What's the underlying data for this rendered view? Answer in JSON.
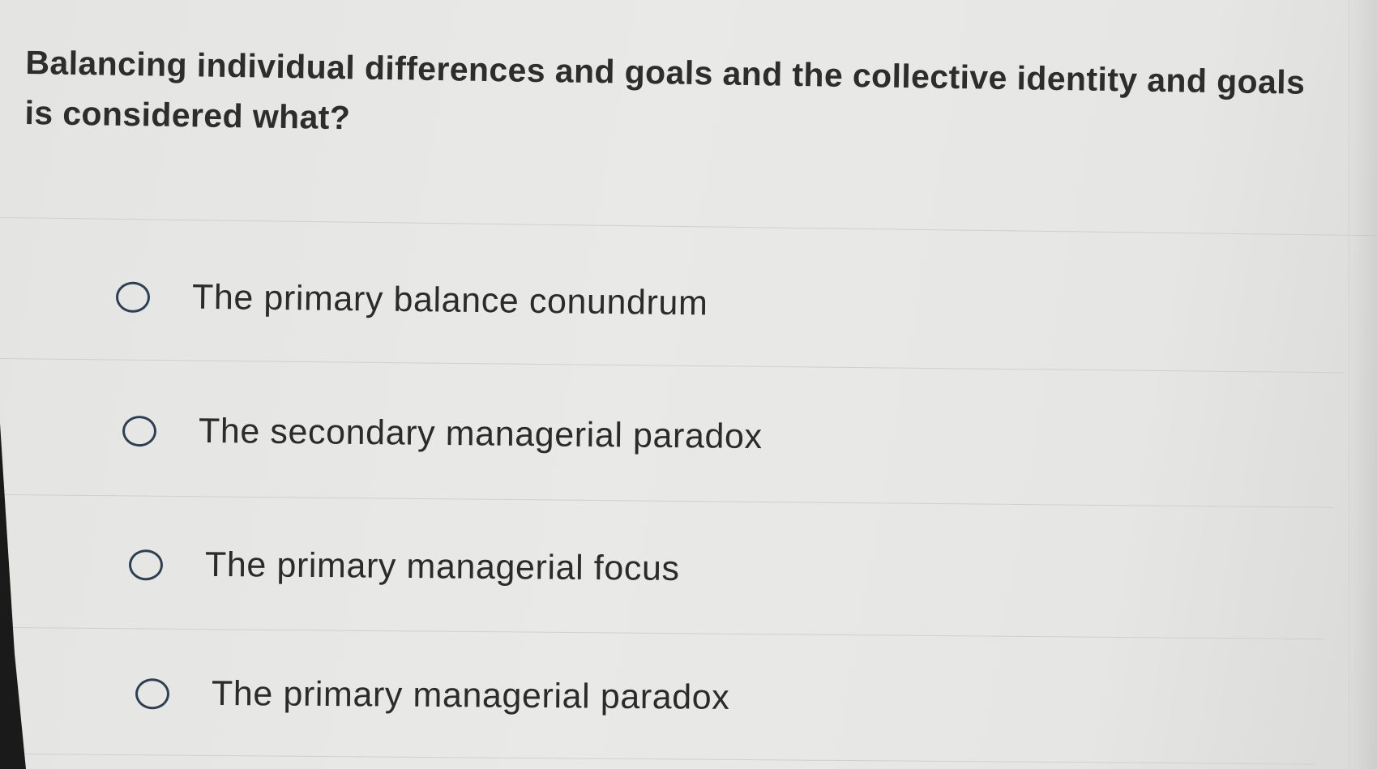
{
  "question": {
    "text": "Balancing individual differences and goals and the collective identity and goals is considered what?"
  },
  "options": [
    {
      "label": "The primary balance conundrum",
      "selected": false
    },
    {
      "label": "The secondary managerial paradox",
      "selected": false
    },
    {
      "label": "The primary managerial focus",
      "selected": false
    },
    {
      "label": "The primary managerial paradox",
      "selected": false
    }
  ],
  "colors": {
    "background": "#e6e6e4",
    "text": "#2b2b2b",
    "radio_border": "#2e3f54",
    "divider": "#d0d0ce"
  }
}
